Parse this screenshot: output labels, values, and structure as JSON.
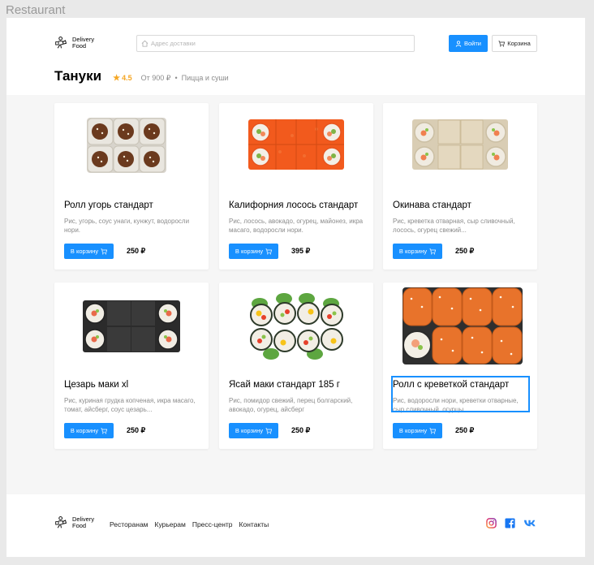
{
  "frame_label": "Restaurant",
  "header": {
    "logo_line1": "Delivery",
    "logo_line2": "Food",
    "search_placeholder": "Адрес доставки",
    "login_label": "Войти",
    "cart_label": "Корзина"
  },
  "restaurant": {
    "title": "Тануки",
    "rating": "4.5",
    "price": "От 900 ₽",
    "separator": "•",
    "category": "Пицца  и суши"
  },
  "cards": [
    {
      "name": "Ролл угорь стандарт",
      "desc": "Рис, угорь, соус унаги, кунжут, водоросли нори.",
      "button": "В корзину",
      "price": "250 ₽"
    },
    {
      "name": "Калифорния лосось стандарт",
      "desc": "Рис, лосось, авокадо, огурец, майонез, икра масаго, водоросли нори.",
      "button": "В корзину",
      "price": "395 ₽"
    },
    {
      "name": "Окинава стандарт",
      "desc": " Рис, креветка отварная, сыр сливочный, лосось, огурец свежий...",
      "button": "В корзину",
      "price": "250 ₽"
    },
    {
      "name": "Цезарь маки xl",
      "desc": "Рис, куриная грудка копченая, икра масаго, томат, айсберг, соус цезарь...",
      "button": "В корзину",
      "price": "250 ₽"
    },
    {
      "name": "Ясай маки стандарт 185 г",
      "desc": "Рис, помидор свежий, перец болгарский, авокадо, огурец, айсберг",
      "button": "В корзину",
      "price": "250 ₽"
    },
    {
      "name": "Ролл с креветкой стандарт",
      "desc": "Рис, водоросли нори, креветки отварные, сыр сливочный, огурцы",
      "button": "В корзину",
      "price": "250 ₽"
    }
  ],
  "footer": {
    "logo_line1": "Delivery",
    "logo_line2": "Food",
    "nav": [
      "Ресторанам",
      "Курьерам",
      "Пресс-центр",
      "Контакты"
    ],
    "social": [
      "instagram-icon",
      "facebook-icon",
      "vk-icon"
    ]
  },
  "colors": {
    "accent": "#1890ff",
    "rating": "#f5a623"
  }
}
